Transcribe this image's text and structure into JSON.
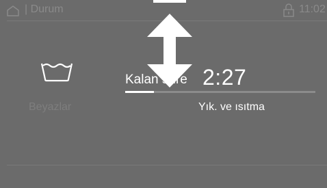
{
  "status_bar": {
    "title": "| Durum",
    "time": "11:02",
    "home_icon": "home-icon",
    "lock_icon": "lock-icon"
  },
  "program": {
    "icon": "wash-tub-icon",
    "name": "Beyazlar"
  },
  "remaining": {
    "label": "Kalan süre",
    "time": "2:27",
    "progress_fraction": 0.15
  },
  "phase": {
    "label": "Yık. ve ısıtma"
  },
  "overlay": {
    "icon": "vertical-double-arrow-icon"
  },
  "colors": {
    "background": "#6b6b6b",
    "text_primary": "#ffffff",
    "text_dim": "#8a8a8a",
    "progress_track": "#8c8c8c",
    "progress_fill": "#ffffff"
  }
}
